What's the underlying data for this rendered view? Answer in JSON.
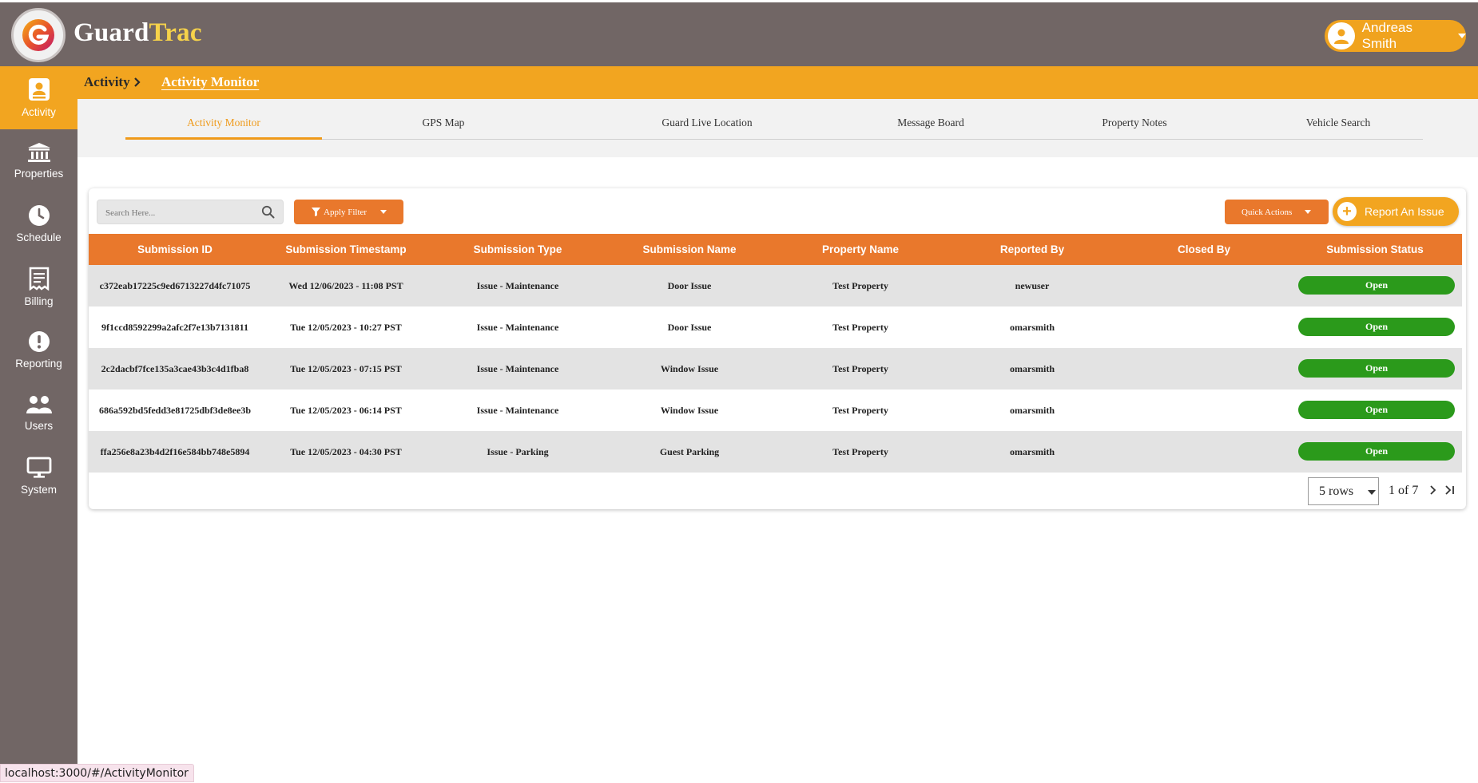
{
  "app": {
    "brand_part1": "Guard",
    "brand_part2": "Trac",
    "user_name": "Andreas Smith"
  },
  "colors": {
    "header_bg": "#716665",
    "accent_orange": "#f2a520",
    "table_orange": "#e9782c",
    "status_green": "#2b9a1b",
    "brand_yellow": "#f6d24a"
  },
  "sidebar": {
    "items": [
      {
        "label": "Activity",
        "icon": "person-badge-icon"
      },
      {
        "label": "Properties",
        "icon": "bank-icon"
      },
      {
        "label": "Schedule",
        "icon": "clock-icon"
      },
      {
        "label": "Billing",
        "icon": "receipt-icon"
      },
      {
        "label": "Reporting",
        "icon": "alert-icon"
      },
      {
        "label": "Users",
        "icon": "users-icon"
      },
      {
        "label": "System",
        "icon": "monitor-icon"
      }
    ]
  },
  "breadcrumb": {
    "parent": "Activity",
    "current": "Activity Monitor"
  },
  "tabs": [
    {
      "label": "Activity Monitor",
      "active": true
    },
    {
      "label": "GPS Map"
    },
    {
      "label": "Guard Live Location"
    },
    {
      "label": "Message Board"
    },
    {
      "label": "Property Notes"
    },
    {
      "label": "Vehicle Search"
    }
  ],
  "toolbar": {
    "search_placeholder": "Search Here...",
    "filter_label": "Apply Filter",
    "quick_actions_label": "Quick Actions",
    "report_label": "Report An Issue"
  },
  "table": {
    "columns": [
      "Submission ID",
      "Submission Timestamp",
      "Submission Type",
      "Submission Name",
      "Property Name",
      "Reported By",
      "Closed By",
      "Submission Status"
    ],
    "rows": [
      [
        "c372eab17225c9ed6713227d4fc71075",
        "Wed 12/06/2023 - 11:08 PST",
        "Issue - Maintenance",
        "Door Issue",
        "Test Property",
        "newuser",
        "",
        "Open"
      ],
      [
        "9f1ccd8592299a2afc2f7e13b7131811",
        "Tue 12/05/2023 - 10:27 PST",
        "Issue - Maintenance",
        "Door Issue",
        "Test Property",
        "omarsmith",
        "",
        "Open"
      ],
      [
        "2c2dacbf7fce135a3cae43b3c4d1fba8",
        "Tue 12/05/2023 - 07:15 PST",
        "Issue - Maintenance",
        "Window Issue",
        "Test Property",
        "omarsmith",
        "",
        "Open"
      ],
      [
        "686a592bd5fedd3e81725dbf3de8ee3b",
        "Tue 12/05/2023 - 06:14 PST",
        "Issue - Maintenance",
        "Window Issue",
        "Test Property",
        "omarsmith",
        "",
        "Open"
      ],
      [
        "ffa256e8a23b4d2f16e584bb748e5894",
        "Tue 12/05/2023 - 04:30 PST",
        "Issue - Parking",
        "Guest Parking",
        "Test Property",
        "omarsmith",
        "",
        "Open"
      ]
    ]
  },
  "pagination": {
    "rows_label": "5 rows",
    "page_info": "1 of 7"
  },
  "status_bar": {
    "url": "localhost:3000/#/ActivityMonitor"
  }
}
